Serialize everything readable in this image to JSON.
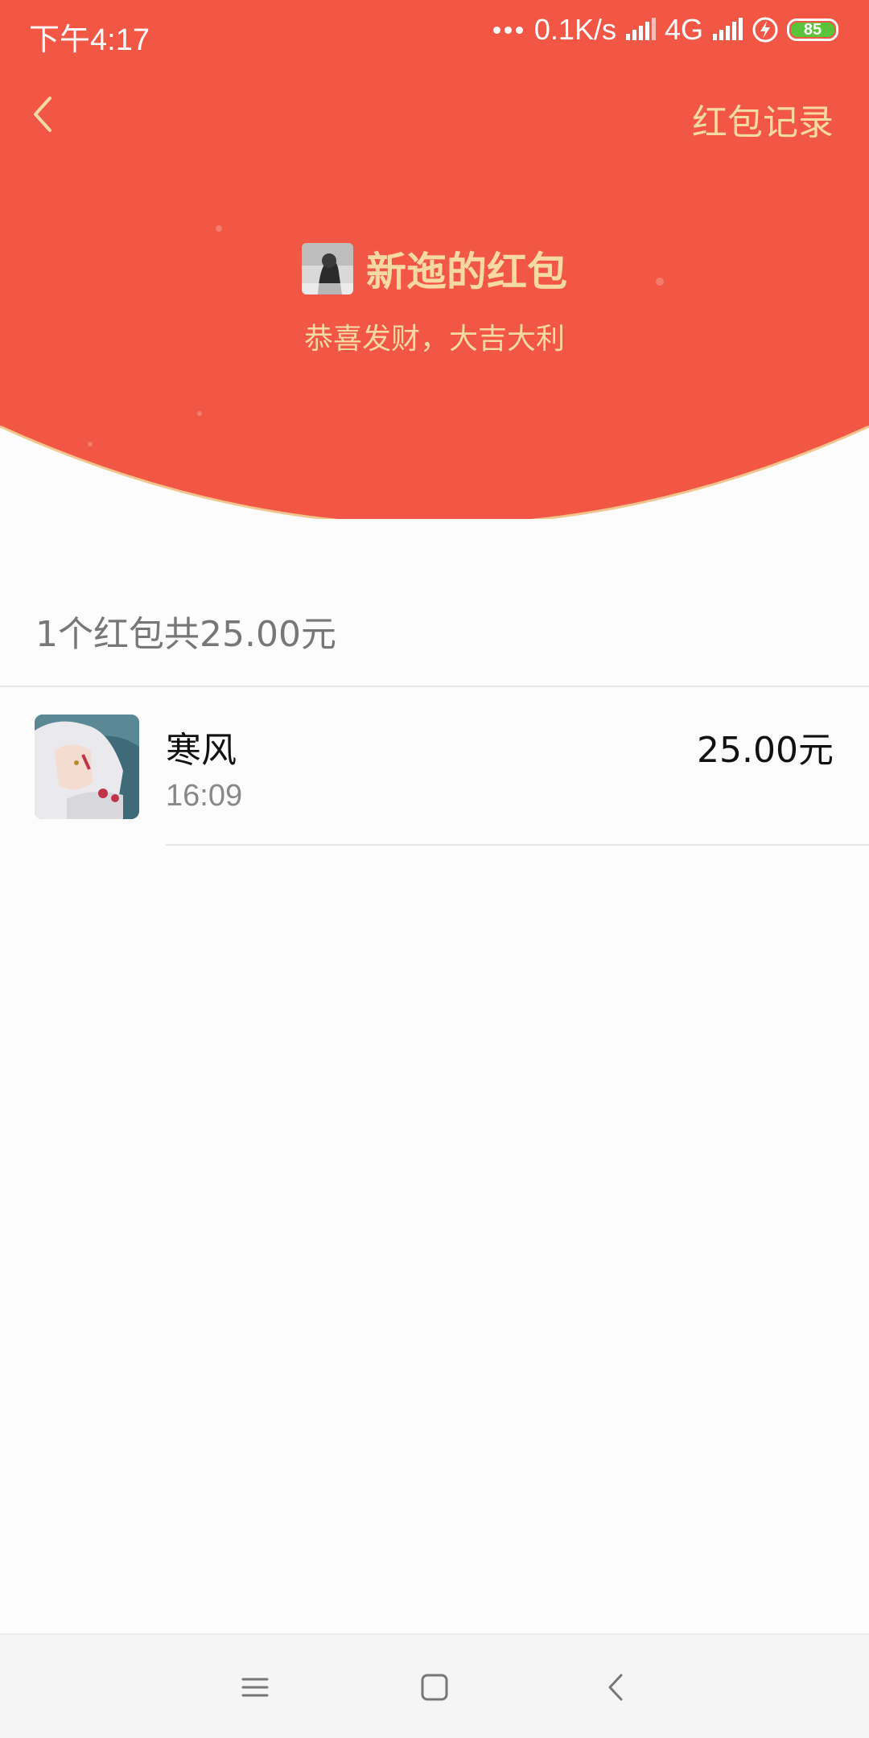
{
  "status_bar": {
    "time": "下午4:17",
    "network_speed": "0.1K/s",
    "network_type": "4G",
    "battery_level": "85",
    "icons": [
      "signal-icon",
      "signal-icon",
      "charging-icon",
      "battery-icon"
    ]
  },
  "header": {
    "record_label": "红包记录",
    "sender_name": "新迤的红包",
    "blessing": "恭喜发财，大吉大利"
  },
  "summary": "1个红包共25.00元",
  "records": [
    {
      "name": "寒风",
      "time": "16:09",
      "amount": "25.00元"
    }
  ],
  "colors": {
    "header_red": "#f25746",
    "gold_text": "#f7d9a4",
    "background": "#fcfcfc"
  }
}
